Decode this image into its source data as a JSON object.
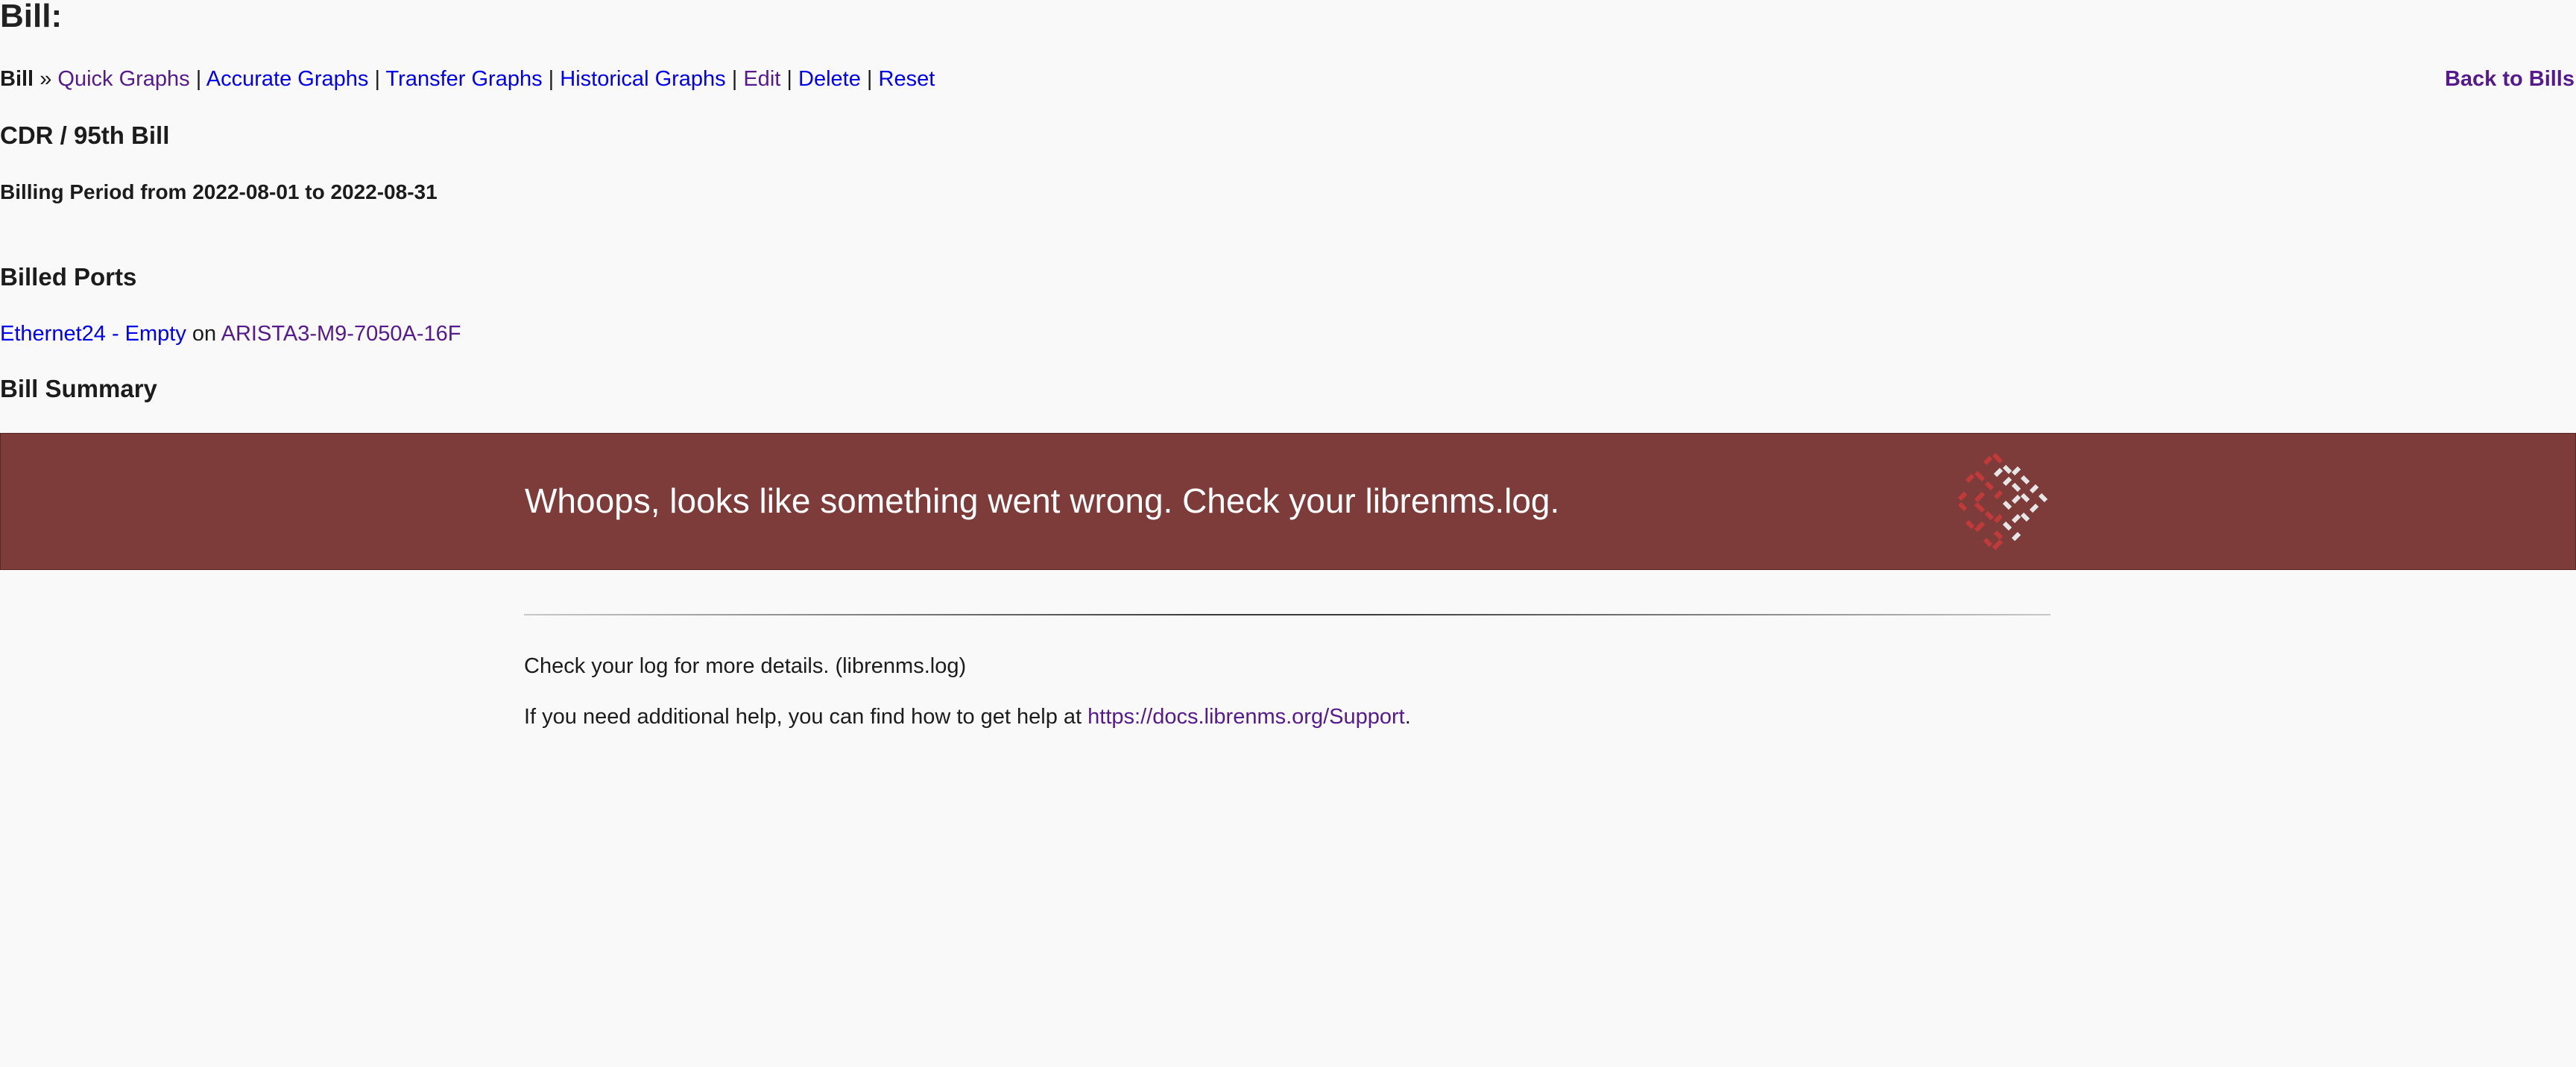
{
  "page": {
    "title": "Bill:"
  },
  "nav": {
    "crumb": "Bill",
    "separator_main": "»",
    "separator": "|",
    "links": {
      "quick_graphs": "Quick Graphs",
      "accurate_graphs": "Accurate Graphs",
      "transfer_graphs": "Transfer Graphs",
      "historical_graphs": "Historical Graphs",
      "edit": "Edit",
      "delete": "Delete",
      "reset": "Reset"
    },
    "back_to_bills": "Back to Bills"
  },
  "bill": {
    "type": "CDR / 95th Bill",
    "billing_period": "Billing Period from 2022-08-01 to 2022-08-31"
  },
  "billed_ports": {
    "heading": "Billed Ports",
    "port_link": "Ethernet24 - Empty",
    "on_word": "on",
    "device_link": "ARISTA3-M9-7050A-16F"
  },
  "summary": {
    "heading": "Bill Summary"
  },
  "error": {
    "message": "Whoops, looks like something went wrong. Check your librenms.log.",
    "logo_icon": "librenms-logo-icon",
    "detail": "Check your log for more details. (librenms.log)",
    "help_prefix": "If you need additional help, you can find how to get help at",
    "help_link": "https://docs.librenms.org/Support",
    "help_suffix": "."
  },
  "colors": {
    "banner_bg": "#7d3c39",
    "link": "#0000ee",
    "link_visited": "#551a8b",
    "page_bg": "#f9f9f9"
  }
}
